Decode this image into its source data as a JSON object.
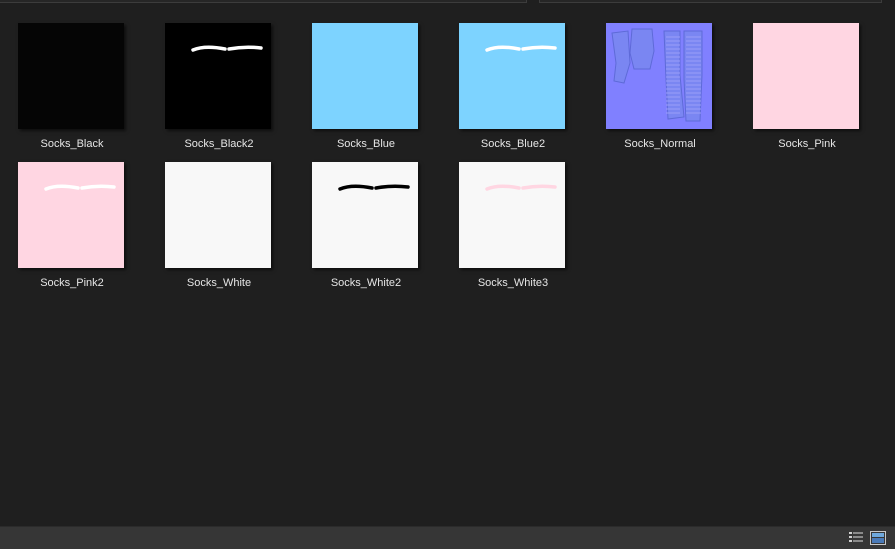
{
  "assets": [
    {
      "name": "Socks_Black",
      "base": "#050505",
      "stroke": null
    },
    {
      "name": "Socks_Black2",
      "base": "#000000",
      "stroke": "#ffffff"
    },
    {
      "name": "Socks_Blue",
      "base": "#7dd3ff",
      "stroke": null
    },
    {
      "name": "Socks_Blue2",
      "base": "#7dd3ff",
      "stroke": "#ffffff"
    },
    {
      "name": "Socks_Normal",
      "base": "#8080ff",
      "stroke": "normal"
    },
    {
      "name": "Socks_Pink",
      "base": "#ffd6e2",
      "stroke": null
    },
    {
      "name": "Socks_Pink2",
      "base": "#ffd6e2",
      "stroke": "#ffffff"
    },
    {
      "name": "Socks_White",
      "base": "#f8f8f8",
      "stroke": null
    },
    {
      "name": "Socks_White2",
      "base": "#f8f8f8",
      "stroke": "#000000"
    },
    {
      "name": "Socks_White3",
      "base": "#f8f8f8",
      "stroke": "#ffd6e2"
    }
  ],
  "status_bar": {
    "list_view_icon": "list-view-icon",
    "thumbnail_view_icon": "thumbnail-view-icon"
  },
  "colors": {
    "background": "#1f1f1f",
    "status_bar": "#363636",
    "label_text": "#e6e6e6"
  }
}
